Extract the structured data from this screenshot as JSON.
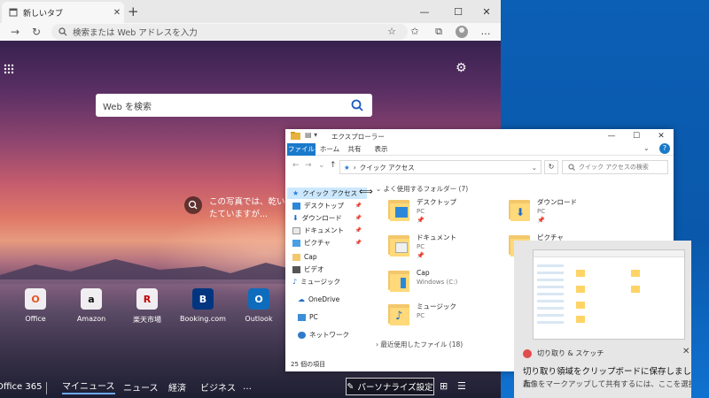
{
  "browser": {
    "tab_title": "新しいタブ",
    "tab_close": "✕",
    "new_tab": "+",
    "address_placeholder": "検索または Web アドレスを入力",
    "window": {
      "minimize": "—",
      "maximize": "☐",
      "close": "✕"
    }
  },
  "newtab": {
    "search_placeholder": "Web を検索",
    "photo_info": "この写真では、乾いたていますが...",
    "tiles": [
      {
        "label": "Office",
        "letter": "O",
        "color": "#e8531f"
      },
      {
        "label": "Amazon",
        "letter": "a",
        "color": "#111111"
      },
      {
        "label": "楽天市場",
        "letter": "R",
        "color": "#bf0000"
      },
      {
        "label": "Booking.com",
        "letter": "B",
        "color": "#003580"
      },
      {
        "label": "Outlook",
        "letter": "O",
        "color": "#0f6cbd"
      }
    ],
    "bottom_links": [
      "Office 365",
      "マイニュース",
      "ニュース",
      "経済",
      "ビジネス",
      "…"
    ],
    "personalize": "パーソナライズ設定"
  },
  "explorer": {
    "title": "エクスプローラー",
    "ribbon_tabs": [
      "ファイル",
      "ホーム",
      "共有",
      "表示"
    ],
    "address_path": "クイック アクセス",
    "search_placeholder": "クイック アクセスの検索",
    "nav_items": [
      {
        "label": "クイック アクセス",
        "icon": "star-icon",
        "pinned": false
      },
      {
        "label": "デスクトップ",
        "icon": "desktop-icon",
        "pinned": true
      },
      {
        "label": "ダウンロード",
        "icon": "download-icon",
        "pinned": true
      },
      {
        "label": "ドキュメント",
        "icon": "document-icon",
        "pinned": true
      },
      {
        "label": "ピクチャ",
        "icon": "picture-icon",
        "pinned": true
      },
      {
        "label": "Cap",
        "icon": "folder-icon",
        "pinned": false
      },
      {
        "label": "ビデオ",
        "icon": "video-icon",
        "pinned": false
      },
      {
        "label": "ミュージック",
        "icon": "music-icon",
        "pinned": false
      },
      {
        "label": "OneDrive",
        "icon": "cloud-icon",
        "pinned": false
      },
      {
        "label": "PC",
        "icon": "pc-icon",
        "pinned": false
      },
      {
        "label": "ネットワーク",
        "icon": "network-icon",
        "pinned": false
      }
    ],
    "frequent_header": "よく使用するフォルダー (7)",
    "folders": [
      {
        "name": "デスクトップ",
        "sub": "PC"
      },
      {
        "name": "ダウンロード",
        "sub": "PC"
      },
      {
        "name": "ドキュメント",
        "sub": "PC"
      },
      {
        "name": "ピクチャ",
        "sub": ""
      },
      {
        "name": "Cap",
        "sub": "Windows (C:)"
      },
      {
        "name": "ミュージック",
        "sub": "PC"
      }
    ],
    "recent_header": "最近使用したファイル (18)",
    "status": "25 個の項目"
  },
  "notification": {
    "app_name": "切り取り & スケッチ",
    "title": "切り取り領域をクリップボードに保存しました",
    "body": "画像をマークアップして共有するには、ここを選択してくださ"
  }
}
